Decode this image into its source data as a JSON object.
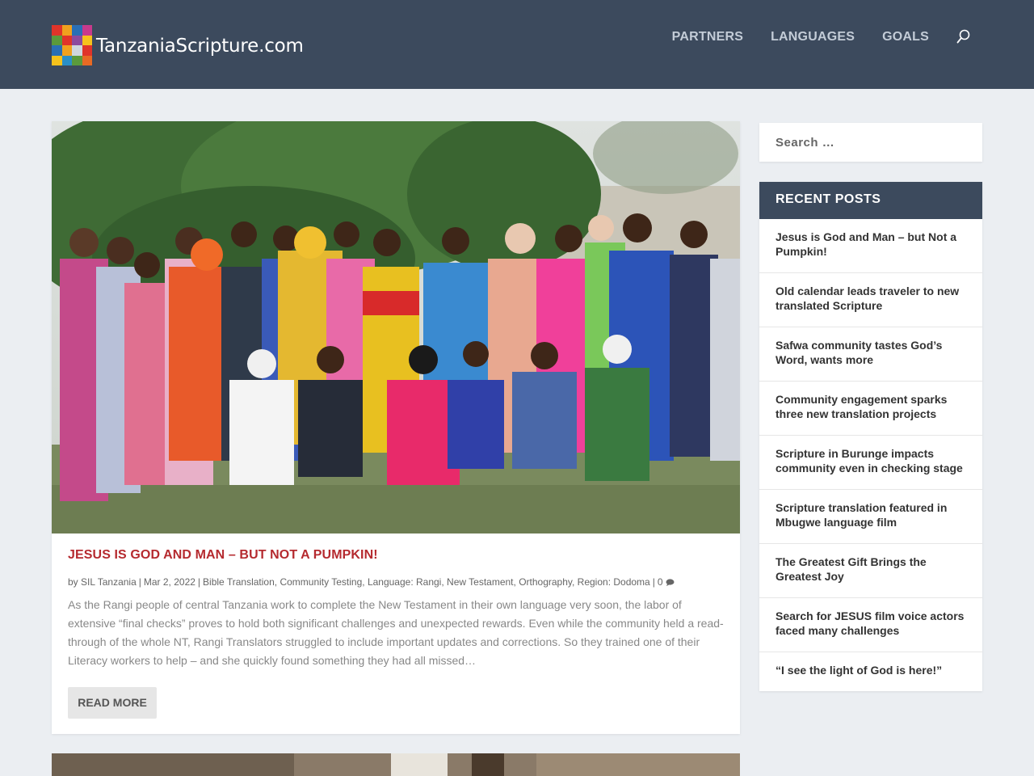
{
  "site": {
    "title": "TanzaniaScripture.com",
    "colors": {
      "header": "#3c4a5d",
      "accent_title": "#b52a2f",
      "background": "#ebeef2"
    }
  },
  "nav": {
    "items": [
      "PARTNERS",
      "LANGUAGES",
      "GOALS"
    ],
    "search_icon": "search-icon"
  },
  "post": {
    "title": "JESUS IS GOD AND MAN – BUT NOT A PUMPKIN!",
    "meta": {
      "by": "by",
      "author": "SIL Tanzania",
      "date": "Mar 2, 2022",
      "categories": [
        "Bible Translation",
        "Community Testing",
        "Language: Rangi",
        "New Testament",
        "Orthography",
        "Region: Dodoma"
      ],
      "comments": "0"
    },
    "excerpt": "As the Rangi people of central Tanzania work to complete the New Testament in their own language very soon, the labor of extensive “final checks” proves to hold both significant challenges and unexpected rewards. Even while the community held a read-through of the whole NT, Rangi Translators struggled to include important updates and corrections. So they trained one of their Literacy workers to help – and she quickly found something they had all missed…",
    "read_more": "READ MORE"
  },
  "sidebar": {
    "search_placeholder": "Search …",
    "recent_title": "RECENT POSTS",
    "recent_posts": [
      "Jesus is God and Man – but Not a Pumpkin!",
      "Old calendar leads traveler to new translated Scripture",
      "Safwa community tastes God’s Word, wants more",
      "Community engagement sparks three new translation projects",
      "Scripture in Burunge impacts community even in checking stage",
      "Scripture translation featured in Mbugwe language film",
      "The Greatest Gift Brings the Greatest Joy",
      "Search for JESUS film voice actors faced many challenges",
      "“I see the light of God is here!”"
    ]
  }
}
